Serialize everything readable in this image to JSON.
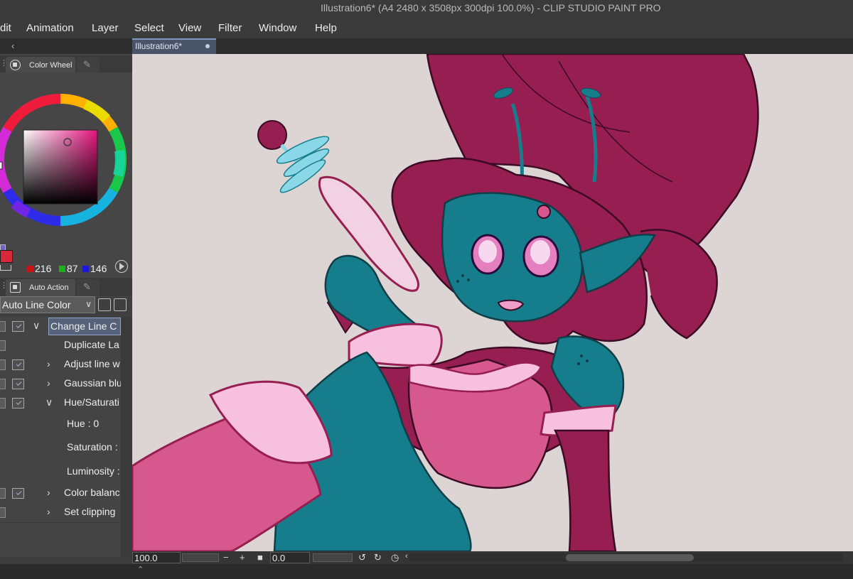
{
  "window": {
    "title": "Illustration6* (A4 2480 x 3508px 300dpi 100.0%)  - CLIP STUDIO PAINT PRO"
  },
  "menubar": {
    "items": [
      "dit",
      "Animation",
      "Layer",
      "Select",
      "View",
      "Filter",
      "Window",
      "Help"
    ]
  },
  "document_tab": {
    "label": "Illustration6*"
  },
  "color_panel": {
    "tab_label": "Color Wheel",
    "rgb": {
      "r": "216",
      "g": "87",
      "b": "146"
    },
    "colors": {
      "main": "#d85792",
      "r_swatch": "#c81414",
      "g_swatch": "#19b319",
      "b_swatch": "#1a1ad6"
    }
  },
  "auto_action_panel": {
    "tab_label": "Auto Action",
    "set_name": "Auto Line Color",
    "actions": [
      {
        "label": "Change Line C",
        "checked": true,
        "dialog": true,
        "twisty": "expanded",
        "selected": true
      },
      {
        "label": "Duplicate La",
        "checked": true,
        "dialog": false,
        "twisty": ""
      },
      {
        "label": "Adjust line w",
        "checked": true,
        "dialog": true,
        "twisty": "collapsed"
      },
      {
        "label": "Gaussian blu",
        "checked": true,
        "dialog": true,
        "twisty": "collapsed"
      },
      {
        "label": "Hue/Saturati",
        "checked": true,
        "dialog": true,
        "twisty": "expanded"
      },
      {
        "label": "Hue : 0",
        "sub": true
      },
      {
        "label": "Saturation :",
        "sub": true
      },
      {
        "label": "Luminosity :",
        "sub": true
      },
      {
        "label": "Color balanc",
        "checked": true,
        "dialog": true,
        "twisty": "collapsed"
      },
      {
        "label": "Set clipping",
        "checked": true,
        "dialog": false,
        "twisty": "collapsed"
      }
    ]
  },
  "statusbar": {
    "zoom": "100.0",
    "angle": "0.0"
  },
  "canvas": {
    "palette": {
      "background": "#dcd5d3",
      "hair": "#961e50",
      "skin": "#167d8c",
      "outline": "#3b0a25",
      "pink": "#d6588d",
      "light_pink": "#f8c0df",
      "light_blue": "#8ad7e8"
    }
  }
}
